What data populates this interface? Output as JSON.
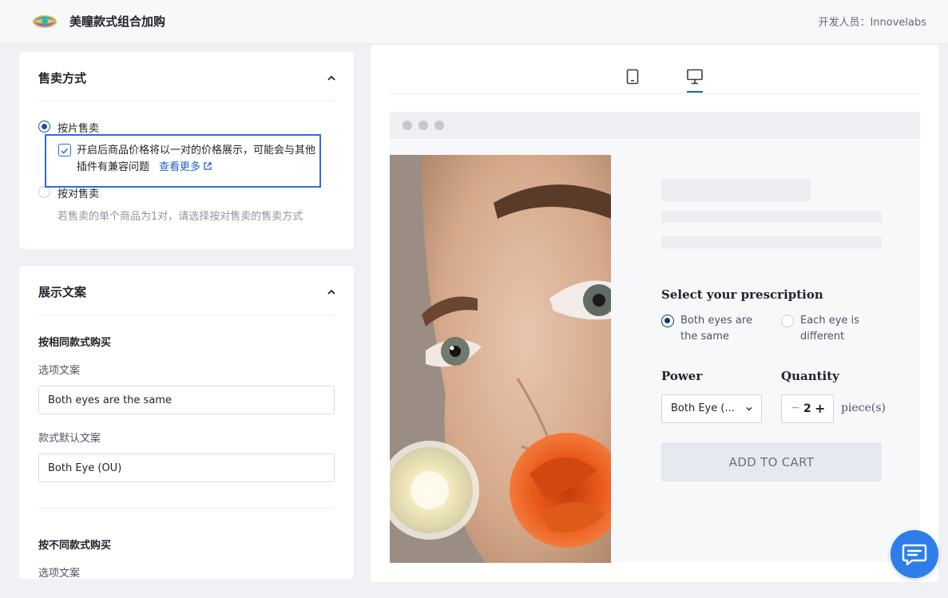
{
  "header": {
    "app_title": "美瞳款式组合加购",
    "developer_label": "开发人员：Innovelabs"
  },
  "sale_method": {
    "title": "售卖方式",
    "option_piece": "按片售卖",
    "checkbox_text": "开启后商品价格将以一对的价格展示，可能会与其他插件有兼容问题",
    "see_more": "查看更多",
    "option_pair": "按对售卖",
    "pair_hint": "若售卖的单个商品为1对，请选择按对售卖的售卖方式"
  },
  "display_copy": {
    "title": "展示文案",
    "same_section": "按相同款式购买",
    "option_copy_label": "选项文案",
    "option_copy_value": "Both eyes are the same",
    "default_copy_label": "款式默认文案",
    "default_copy_value": "Both Eye (OU)",
    "diff_section": "按不同款式购买",
    "diff_option_copy_label": "选项文案"
  },
  "preview": {
    "devices": [
      "tablet-icon",
      "desktop-icon"
    ],
    "active_device": "desktop",
    "prescription_title": "Select your prescription",
    "option_same": "Both eyes are the same",
    "option_different": "Each eye is different",
    "power_label": "Power",
    "quantity_label": "Quantity",
    "power_value": "Both Eye (...",
    "quantity_value": "2",
    "minus": "−",
    "plus": "+",
    "unit": "piece(s)",
    "add_to_cart": "ADD TO CART"
  },
  "colors": {
    "accent": "#1f5fd6",
    "highlight_border": "#2f6bdc",
    "radio_selected": "#1e4ea8",
    "chat_button": "#2d7ee8"
  }
}
